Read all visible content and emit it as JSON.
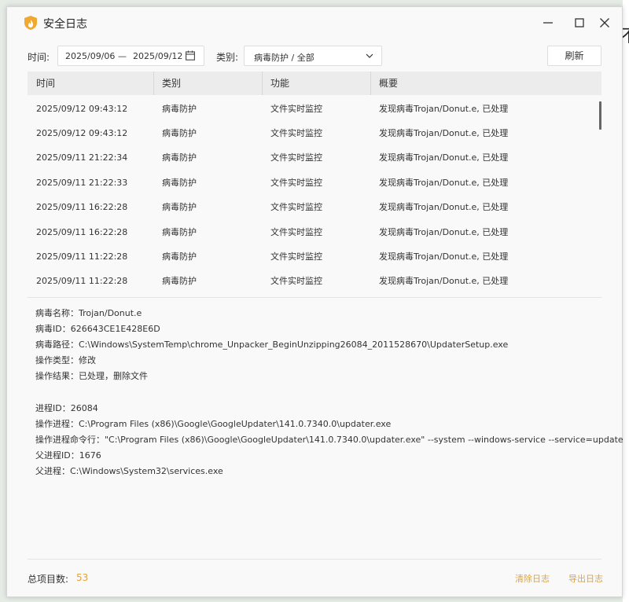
{
  "window": {
    "title": "安全日志"
  },
  "background": {
    "glyph": "不"
  },
  "colors": {
    "accent": "#e0a33a",
    "logo": "#f0a830",
    "header_bg": "#ececec"
  },
  "icons": {
    "logo": "fire-shield-icon",
    "minimize": "minimize-icon",
    "maximize": "maximize-icon",
    "close": "close-icon",
    "calendar": "calendar-icon",
    "dropdown": "chevron-down-icon"
  },
  "filters": {
    "time_label": "时间:",
    "date_start": "2025/09/06",
    "date_sep": "—",
    "date_end": "2025/09/12",
    "category_label": "类别:",
    "category_value": "病毒防护 / 全部",
    "refresh_label": "刷新"
  },
  "table": {
    "headers": [
      "时间",
      "类别",
      "功能",
      "概要"
    ],
    "rows": [
      [
        "2025/09/12 09:43:12",
        "病毒防护",
        "文件实时监控",
        "发现病毒Trojan/Donut.e, 已处理"
      ],
      [
        "2025/09/12 09:43:12",
        "病毒防护",
        "文件实时监控",
        "发现病毒Trojan/Donut.e, 已处理"
      ],
      [
        "2025/09/11 21:22:34",
        "病毒防护",
        "文件实时监控",
        "发现病毒Trojan/Donut.e, 已处理"
      ],
      [
        "2025/09/11 21:22:33",
        "病毒防护",
        "文件实时监控",
        "发现病毒Trojan/Donut.e, 已处理"
      ],
      [
        "2025/09/11 16:22:28",
        "病毒防护",
        "文件实时监控",
        "发现病毒Trojan/Donut.e, 已处理"
      ],
      [
        "2025/09/11 16:22:28",
        "病毒防护",
        "文件实时监控",
        "发现病毒Trojan/Donut.e, 已处理"
      ],
      [
        "2025/09/11 11:22:28",
        "病毒防护",
        "文件实时监控",
        "发现病毒Trojan/Donut.e, 已处理"
      ],
      [
        "2025/09/11 11:22:28",
        "病毒防护",
        "文件实时监控",
        "发现病毒Trojan/Donut.e, 已处理"
      ]
    ]
  },
  "details": {
    "virus_name": "病毒名称：Trojan/Donut.e",
    "virus_id": "病毒ID：626643CE1E428E6D",
    "virus_path": "病毒路径：C:\\Windows\\SystemTemp\\chrome_Unpacker_BeginUnzipping26084_2011528670\\UpdaterSetup.exe",
    "op_type": "操作类型：修改",
    "op_result": "操作结果：已处理，删除文件",
    "pid": "进程ID：26084",
    "process": "操作进程：C:\\Program Files (x86)\\Google\\GoogleUpdater\\141.0.7340.0\\updater.exe",
    "cmdline": "操作进程命令行：\"C:\\Program Files (x86)\\Google\\GoogleUpdater\\141.0.7340.0\\updater.exe\" --system --windows-service --service=update",
    "ppid": "父进程ID：1676",
    "parent": "父进程：C:\\Windows\\System32\\services.exe"
  },
  "footer": {
    "count_label": "总项目数:",
    "count_value": "53",
    "clear_label": "清除日志",
    "export_label": "导出日志"
  }
}
